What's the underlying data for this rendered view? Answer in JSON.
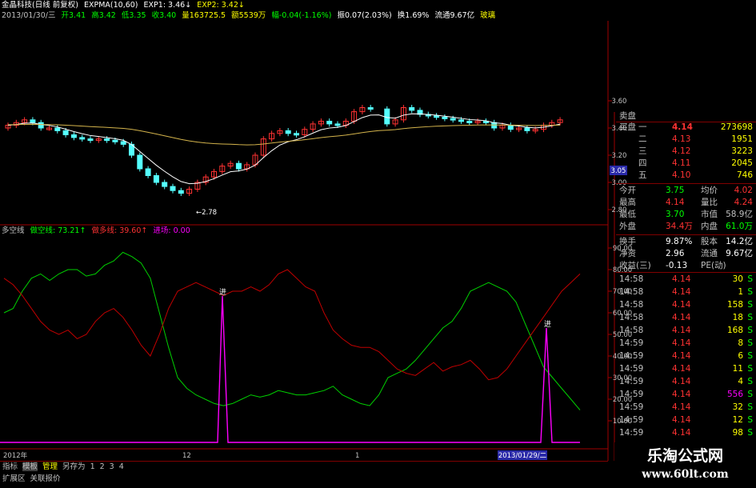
{
  "header": {
    "title": "金晶科技(日线 前复权)",
    "indicator": "EXPMA(10,60)",
    "exp1": "EXP1: 3.46↓",
    "exp2": "EXP2: 3.42↓",
    "date": "2013/01/30/三",
    "open": "开3.41",
    "high": "高3.42",
    "low": "低3.35",
    "close": "收3.40",
    "volume": "量163725.5",
    "amount": "额5539万",
    "change": "幅-0.04(-1.16%)",
    "amp": "振0.07(2.03%)",
    "turnover": "换1.69%",
    "circulation": "流通9.67亿",
    "sector": "玻璃"
  },
  "indicator_header": {
    "name": "多空线",
    "short_line": "做空线: 73.21↑",
    "long_line": "做多线: 39.60↑",
    "entry": "进场: 0.00"
  },
  "price_axis": [
    "3.60",
    "3.40",
    "3.20",
    "3.00",
    "2.80"
  ],
  "price_label_box": "3.05",
  "low_annot": "2.78",
  "ind_axis": [
    "90.00",
    "80.00",
    "70.00",
    "60.00",
    "50.00",
    "40.00",
    "30.00",
    "20.00",
    "10.00"
  ],
  "ind_markers": [
    "进",
    "进"
  ],
  "date_axis": {
    "left": "2012年",
    "mid1": "12",
    "mid2": "1",
    "cursor": "2013/01/29/二"
  },
  "bottom_tabs": [
    "指标",
    "模板",
    "管理",
    "另存为",
    "1",
    "2",
    "3",
    "4"
  ],
  "bottom_tabs2": [
    "扩展区",
    "关联报价"
  ],
  "quote": {
    "sell_label": "卖盘",
    "buy_label": "买盘",
    "buy_levels": [
      {
        "label": "一",
        "price": "4.14",
        "vol": "273698"
      },
      {
        "label": "二",
        "price": "4.13",
        "vol": "1951"
      },
      {
        "label": "三",
        "price": "4.12",
        "vol": "3223"
      },
      {
        "label": "四",
        "price": "4.11",
        "vol": "2045"
      },
      {
        "label": "五",
        "price": "4.10",
        "vol": "746"
      }
    ],
    "stats": [
      {
        "k1": "今开",
        "v1": "3.75",
        "k2": "均价",
        "v2": "4.02"
      },
      {
        "k1": "最高",
        "v1": "4.14",
        "k2": "量比",
        "v2": "4.24"
      },
      {
        "k1": "最低",
        "v1": "3.70",
        "k2": "市值",
        "v2": "58.9亿"
      },
      {
        "k1": "外盘",
        "v1": "34.4万",
        "k2": "内盘",
        "v2": "61.0万"
      }
    ],
    "stats2": [
      {
        "k1": "换手",
        "v1": "9.87%",
        "k2": "股本",
        "v2": "14.2亿"
      },
      {
        "k1": "净资",
        "v1": "2.96",
        "k2": "流通",
        "v2": "9.67亿"
      },
      {
        "k1": "收益(三)",
        "v1": "-0.13",
        "k2": "PE(动)",
        "v2": ""
      }
    ],
    "ticks": [
      {
        "t": "14:58",
        "p": "4.14",
        "v": "30",
        "s": "S"
      },
      {
        "t": "14:58",
        "p": "4.14",
        "v": "1",
        "s": "S"
      },
      {
        "t": "14:58",
        "p": "4.14",
        "v": "158",
        "s": "S"
      },
      {
        "t": "14:58",
        "p": "4.14",
        "v": "18",
        "s": "S"
      },
      {
        "t": "14:58",
        "p": "4.14",
        "v": "168",
        "s": "S"
      },
      {
        "t": "14:59",
        "p": "4.14",
        "v": "8",
        "s": "S"
      },
      {
        "t": "14:59",
        "p": "4.14",
        "v": "6",
        "s": "S"
      },
      {
        "t": "14:59",
        "p": "4.14",
        "v": "11",
        "s": "S"
      },
      {
        "t": "14:59",
        "p": "4.14",
        "v": "4",
        "s": "S"
      },
      {
        "t": "14:59",
        "p": "4.14",
        "v": "556",
        "s": "S"
      },
      {
        "t": "14:59",
        "p": "4.14",
        "v": "32",
        "s": "S"
      },
      {
        "t": "14:59",
        "p": "4.14",
        "v": "12",
        "s": "S"
      },
      {
        "t": "14:59",
        "p": "4.14",
        "v": "98",
        "s": "S"
      }
    ]
  },
  "watermark": {
    "line1": "乐淘公式网",
    "line2": "www.60lt.com"
  },
  "colors": {
    "up": "#ff3232",
    "down": "#54ffff",
    "ma_short": "#ffffff",
    "ma_long": "#d4b44c",
    "short_line": "#00d000",
    "long_line": "#c00000",
    "entry": "#ff00ff",
    "axis": "#a00000"
  }
}
